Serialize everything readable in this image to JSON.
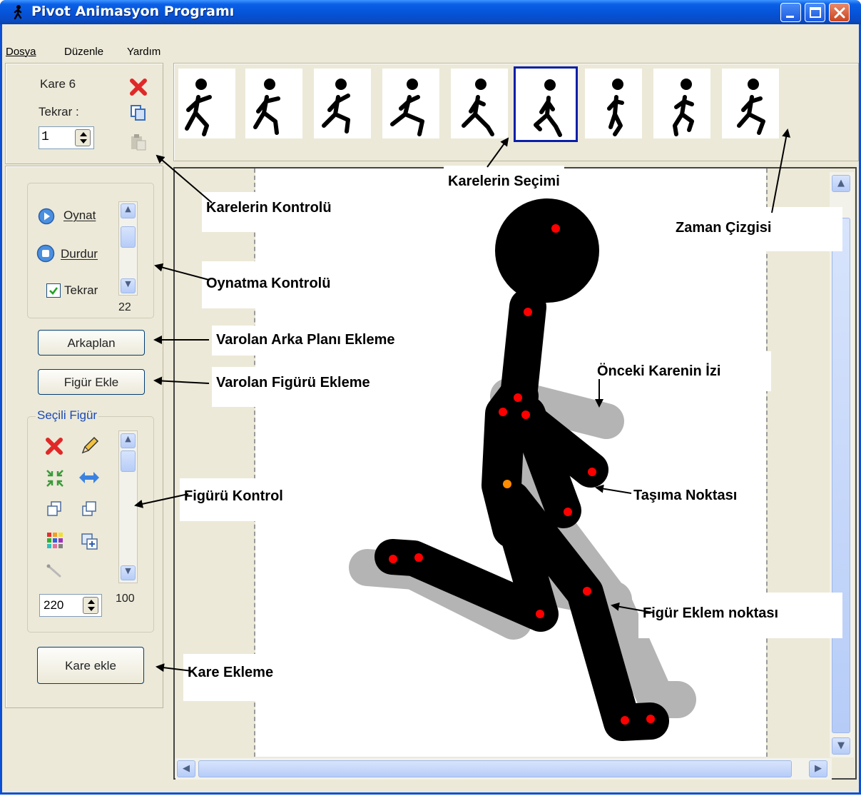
{
  "window": {
    "title": "Pivot Animasyon Programı"
  },
  "menu": {
    "dosya": "Dosya",
    "duzenle": "Düzenle",
    "yardim": "Yardım"
  },
  "frame_panel": {
    "frame_label": "Kare 6",
    "repeat_label": "Tekrar :",
    "repeat_value": "1"
  },
  "playback": {
    "play_label": "Oynat",
    "stop_label": "Durdur",
    "loop_label": "Tekrar",
    "loop_checked": true,
    "speed_value": "22"
  },
  "buttons": {
    "background": "Arkaplan",
    "add_figure": "Figür Ekle",
    "add_frame": "Kare ekle"
  },
  "selected_figure": {
    "group_label": "Seçili Figür",
    "size_value": "220",
    "opacity_value": "100"
  },
  "timeline": {
    "frame_count": 9,
    "selected_index": 5
  },
  "callouts": {
    "frame_control": "Karelerin Kontrolü",
    "frame_selection": "Karelerin Seçimi",
    "timeline": "Zaman Çizgisi",
    "playback_control": "Oynatma Kontrolü",
    "add_background": "Varolan Arka Planı Ekleme",
    "add_figure": "Varolan Figürü Ekleme",
    "onion_skin": "Önceki Karenin İzi",
    "figure_control": "Figürü Kontrol",
    "move_point": "Taşıma Noktası",
    "joint_point": "Figür Eklem noktası",
    "add_frame": "Kare Ekleme"
  },
  "colors": {
    "title_blue": "#0553d8",
    "joint_red": "#ff0000",
    "move_orange": "#ff8c00",
    "onion_gray": "#b4b4b4",
    "selection_blue": "#0a1fa8"
  }
}
